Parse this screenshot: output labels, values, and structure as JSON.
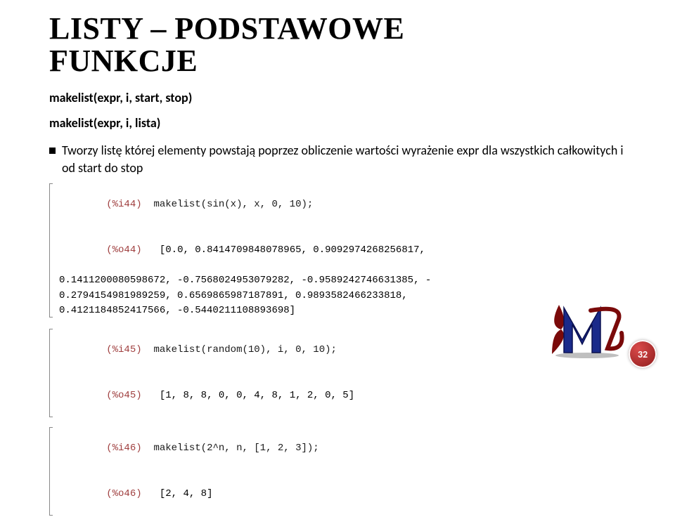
{
  "title_line1": "LISTY – PODSTAWOWE",
  "title_line2": "FUNKCJE",
  "syntax1": "makelist(expr, i, start, stop)",
  "syntax2": "makelist(expr, i, lista)",
  "bullet": "Tworzy listę której elementy powstają poprzez obliczenie wartości wyrażenie expr dla wszystkich całkowitych i od start do stop",
  "cells": [
    {
      "in_label": "(%i44)",
      "in_cmd": "makelist(sin(x), x, 0, 10);",
      "out_label": "(%o44)",
      "out_lines": [
        "[0.0, 0.8414709848078965, 0.9092974268256817,",
        "0.1411200080598672, -0.7568024953079282, -0.9589242746631385, -",
        "0.2794154981989259, 0.6569865987187891, 0.9893582466233818,",
        "0.4121184852417566, -0.5440211108893698]"
      ]
    },
    {
      "in_label": "(%i45)",
      "in_cmd": "makelist(random(10), i, 0, 10);",
      "out_label": "(%o45)",
      "out_lines": [
        "[1, 8, 8, 0, 0, 4, 8, 1, 2, 0, 5]"
      ]
    },
    {
      "in_label": "(%i46)",
      "in_cmd": "makelist(2^n, n, [1, 2, 3]);",
      "out_label": "(%o46)",
      "out_lines": [
        "[2, 4, 8]"
      ]
    }
  ],
  "page_number": "32"
}
